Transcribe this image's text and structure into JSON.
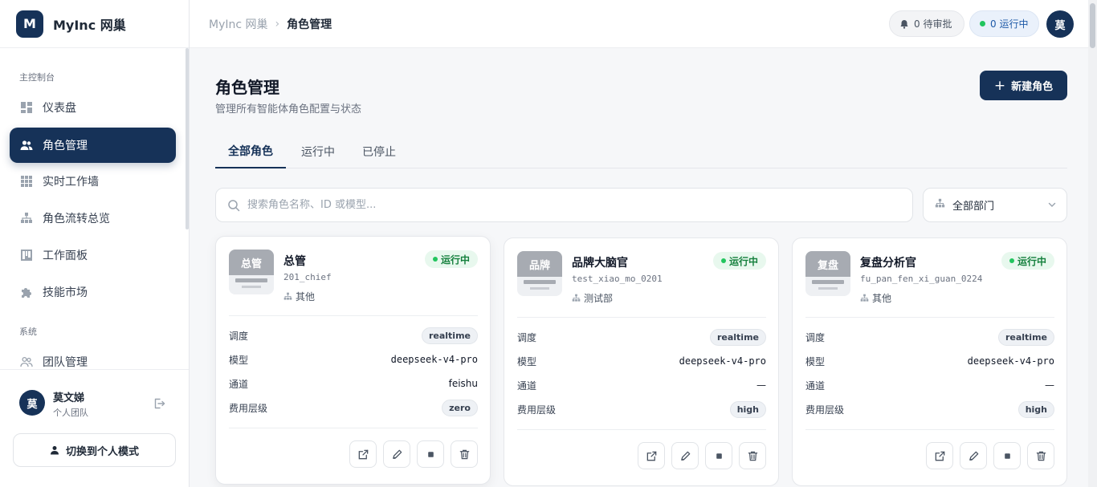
{
  "brand": {
    "logo": "M",
    "name": "MyInc 网巢"
  },
  "sidebar": {
    "section_main": "主控制台",
    "section_system": "系统",
    "items": [
      {
        "label": "仪表盘",
        "icon": "dashboard-icon"
      },
      {
        "label": "角色管理",
        "icon": "users-icon",
        "active": true
      },
      {
        "label": "实时工作墙",
        "icon": "grid-icon"
      },
      {
        "label": "角色流转总览",
        "icon": "org-icon"
      },
      {
        "label": "工作面板",
        "icon": "board-icon"
      },
      {
        "label": "技能市场",
        "icon": "puzzle-icon"
      },
      {
        "label": "团队管理",
        "icon": "team-icon"
      }
    ],
    "user": {
      "avatar": "莫",
      "name": "莫文娣",
      "team": "个人团队"
    },
    "switch_label": "切换到个人模式"
  },
  "header": {
    "breadcrumb": [
      "MyInc 网巢",
      "角色管理"
    ],
    "pending_approval": "0 待审批",
    "running": "0 运行中",
    "avatar": "莫"
  },
  "main": {
    "title": "角色管理",
    "subtitle": "管理所有智能体角色配置与状态",
    "new_button": "新建角色",
    "tabs": [
      "全部角色",
      "运行中",
      "已停止"
    ],
    "search_placeholder": "搜索角色名称、ID 或模型...",
    "dept_filter": "全部部门"
  },
  "field_labels": {
    "schedule": "调度",
    "model": "模型",
    "channel": "通道",
    "cost_tier": "费用层级"
  },
  "cards": [
    {
      "thumb": "总管",
      "name": "总管",
      "id": "201_chief",
      "dept": "其他",
      "status": "运行中",
      "schedule": "realtime",
      "model": "deepseek-v4-pro",
      "channel": "feishu",
      "cost_tier": "zero"
    },
    {
      "thumb": "品牌",
      "name": "品牌大脑官",
      "id": "test_xiao_mo_0201",
      "dept": "测试部",
      "status": "运行中",
      "schedule": "realtime",
      "model": "deepseek-v4-pro",
      "channel": "—",
      "cost_tier": "high"
    },
    {
      "thumb": "复盘",
      "name": "复盘分析官",
      "id": "fu_pan_fen_xi_guan_0224",
      "dept": "其他",
      "status": "运行中",
      "schedule": "realtime",
      "model": "deepseek-v4-pro",
      "channel": "—",
      "cost_tier": "high"
    }
  ],
  "colors": {
    "brand": "#163258",
    "running_green": "#22c55e",
    "status_bg": "#e8f8ee"
  }
}
